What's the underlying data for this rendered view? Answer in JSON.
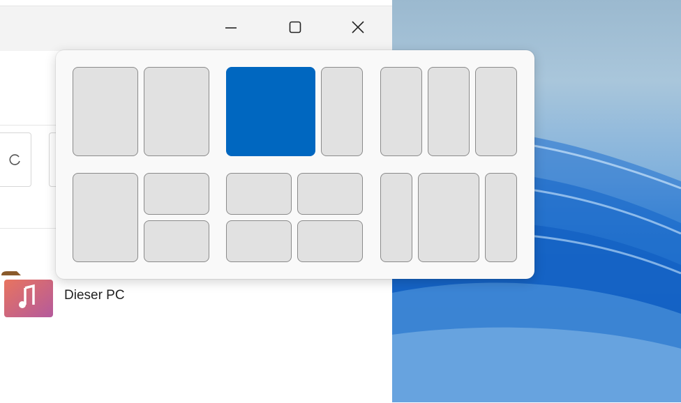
{
  "window": {
    "controls": {
      "minimize_icon": "minimize-icon",
      "maximize_icon": "maximize-icon",
      "close_icon": "close-icon"
    }
  },
  "content": {
    "item": {
      "label": "Dieser PC",
      "icon": "music-folder-icon"
    }
  },
  "snap_layouts": {
    "layouts": [
      {
        "name": "half-halves",
        "zones": 2,
        "active_zone": null
      },
      {
        "name": "two-thirds-one-third",
        "zones": 2,
        "active_zone": 1
      },
      {
        "name": "three-columns",
        "zones": 3,
        "active_zone": null
      },
      {
        "name": "half-and-two-quarters",
        "zones": 3,
        "active_zone": null
      },
      {
        "name": "four-quadrants",
        "zones": 4,
        "active_zone": null
      },
      {
        "name": "narrow-wide-narrow",
        "zones": 3,
        "active_zone": null
      }
    ]
  },
  "colors": {
    "accent": "#0067c0",
    "zone_fill": "#e1e1e1",
    "flyout_bg": "#f9f9f9",
    "titlebar_bg": "#f3f3f3"
  }
}
